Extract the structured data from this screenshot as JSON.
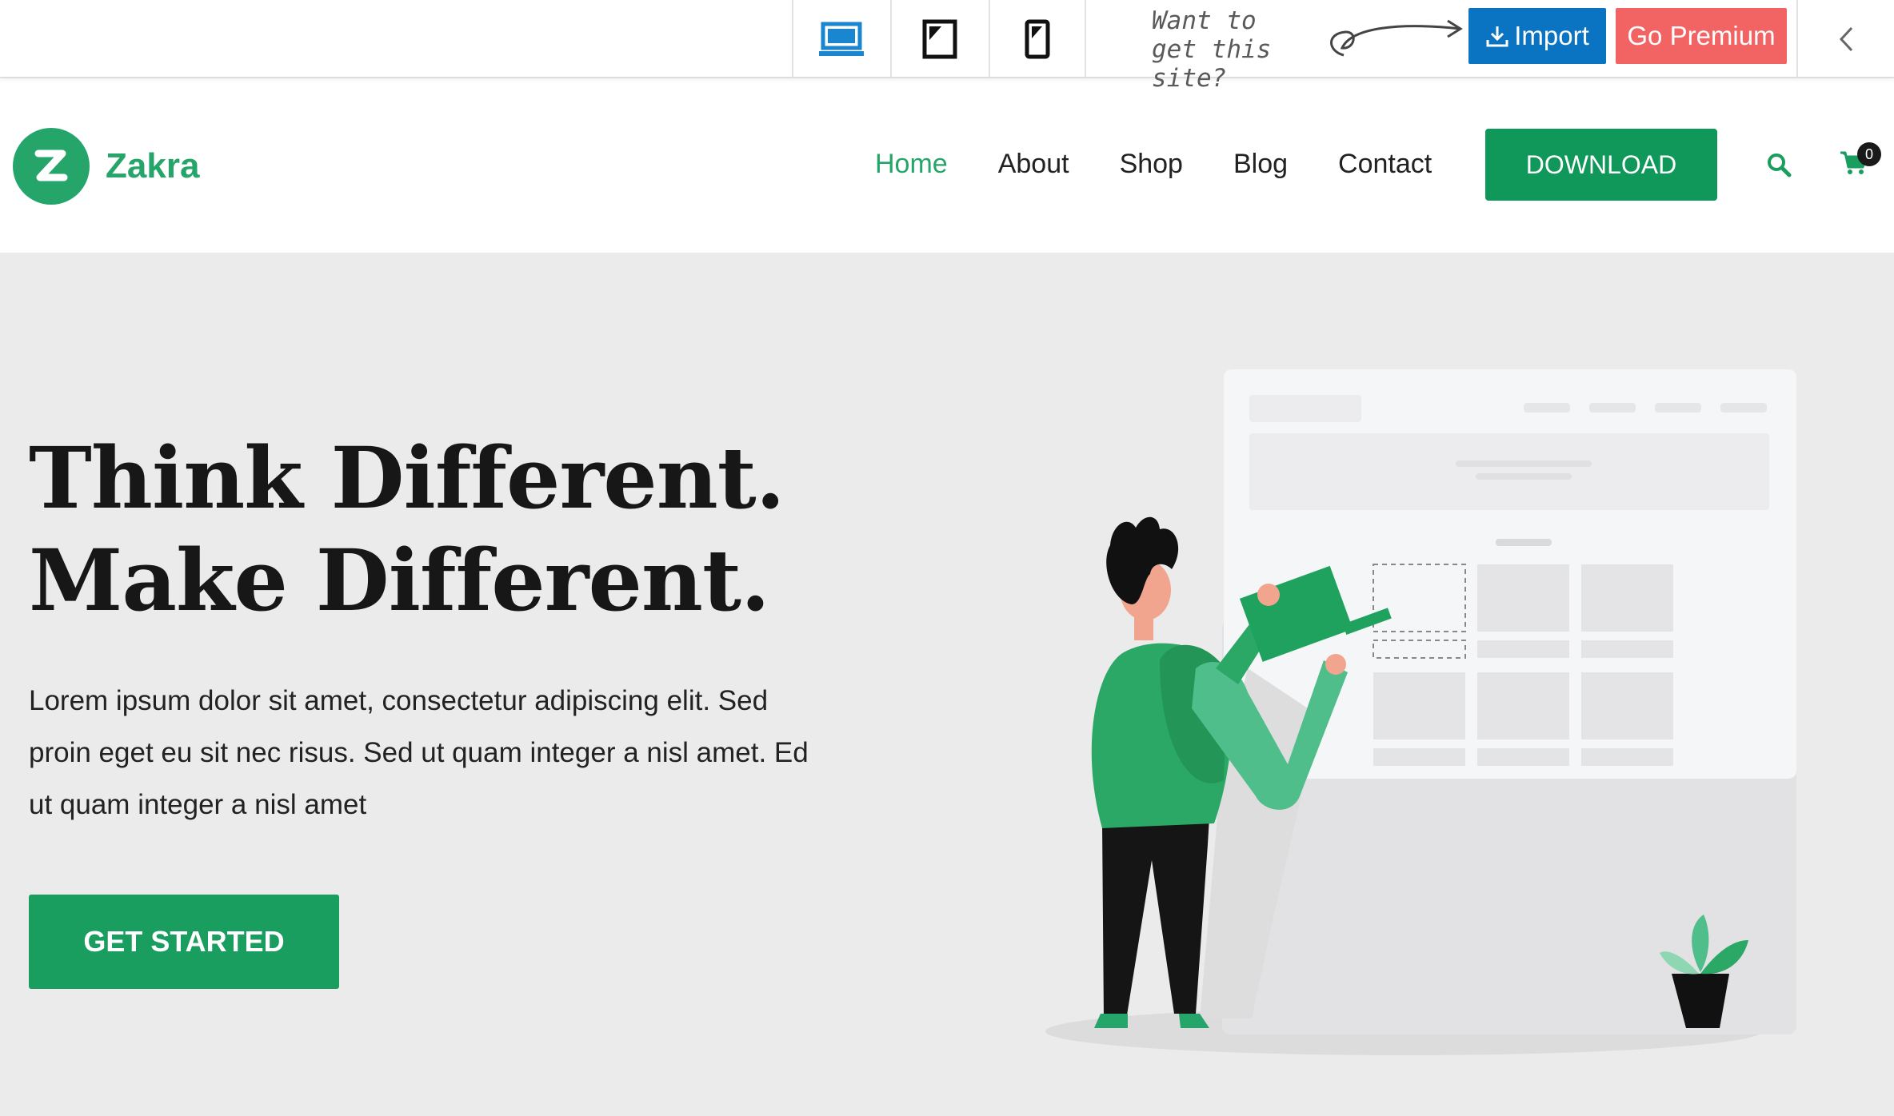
{
  "topbar": {
    "devices": [
      {
        "name": "desktop",
        "icon": "desktop-icon",
        "active": true
      },
      {
        "name": "tablet",
        "icon": "tablet-icon",
        "active": false
      },
      {
        "name": "mobile",
        "icon": "mobile-icon",
        "active": false
      }
    ],
    "want_line1": "Want to",
    "want_line2": "get this site?",
    "import_label": "Import",
    "premium_label": "Go Premium",
    "colors": {
      "import": "#0a73c2",
      "premium": "#f26463"
    }
  },
  "header": {
    "logo_text": "Zakra",
    "nav": [
      "Home",
      "About",
      "Shop",
      "Blog",
      "Contact"
    ],
    "active_nav": "Home",
    "download_label": "DOWNLOAD",
    "cart_count": "0",
    "colors": {
      "brand": "#26a56b",
      "button": "#10975a"
    }
  },
  "hero": {
    "title_line1": "Think Different.",
    "title_line2": "Make Different.",
    "text": "Lorem ipsum dolor sit amet, consectetur adipiscing elit. Sed proin eget eu sit nec risus. Sed ut quam integer a nisl amet.  Ed ut quam integer a nisl amet",
    "button_label": "GET STARTED"
  }
}
